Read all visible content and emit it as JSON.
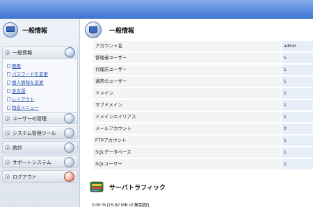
{
  "sidebar": {
    "title": "一般情報",
    "open_section": {
      "label": "一般情報",
      "links": [
        "概要",
        "パスワードを変更",
        "個人情報を変更",
        "多言語",
        "レイアウト",
        "独自メニュー"
      ]
    },
    "sections": [
      {
        "label": "ユーザーの管理",
        "icon": "users-icon"
      },
      {
        "label": "システム管理ツール",
        "icon": "tools-icon"
      },
      {
        "label": "統計",
        "icon": "stats-icon"
      },
      {
        "label": "サポートシステム",
        "icon": "support-icon"
      },
      {
        "label": "ログアウト",
        "icon": "logout-icon"
      }
    ]
  },
  "main": {
    "title": "一般情報",
    "info_rows": [
      {
        "key": "アカウント名",
        "value": "admin"
      },
      {
        "key": "管理者ユーザー",
        "value": "1"
      },
      {
        "key": "代理店ユーザー",
        "value": "1"
      },
      {
        "key": "通常のユーザー",
        "value": "1"
      },
      {
        "key": "ドメイン",
        "value": "1"
      },
      {
        "key": "サブドメイン",
        "value": "1"
      },
      {
        "key": "ドメインエイリアス",
        "value": "1"
      },
      {
        "key": "メールアカウント",
        "value": "0"
      },
      {
        "key": "FTPアカウント",
        "value": "1"
      },
      {
        "key": "SQLデータベース",
        "value": "1"
      },
      {
        "key": "SQLユーザー",
        "value": "1"
      }
    ],
    "traffic": {
      "title": "サーバトラフィック",
      "usage": "0.00 % [15.82 MB of 無制限]"
    }
  },
  "colors": {
    "topbar": "#4f82d8",
    "link": "#2a4fb0",
    "value_cell": "#e8eef8"
  }
}
